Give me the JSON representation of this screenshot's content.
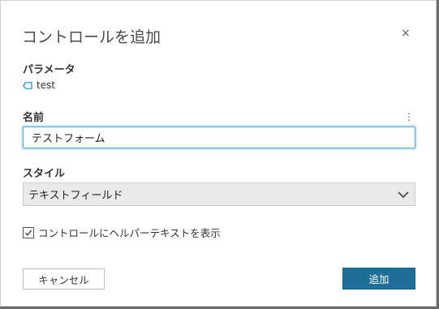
{
  "dialog": {
    "title": "コントロールを追加",
    "close_label": "×"
  },
  "parameter": {
    "label": "パラメータ",
    "value": "test",
    "icon": "tag-icon",
    "icon_color": "#1d8bbf"
  },
  "name": {
    "label": "名前",
    "value": "テストフォーム",
    "menu_icon": "more-vertical-icon",
    "menu_glyph": "⋮"
  },
  "style": {
    "label": "スタイル",
    "selected": "テキストフィールド",
    "chevron_icon": "chevron-down-icon"
  },
  "helper": {
    "label": "コントロールにヘルパーテキストを表示",
    "checked": true
  },
  "buttons": {
    "cancel": "キャンセル",
    "add": "追加"
  },
  "colors": {
    "primary": "#1d6f97",
    "focus_border": "#5aa7d6"
  }
}
